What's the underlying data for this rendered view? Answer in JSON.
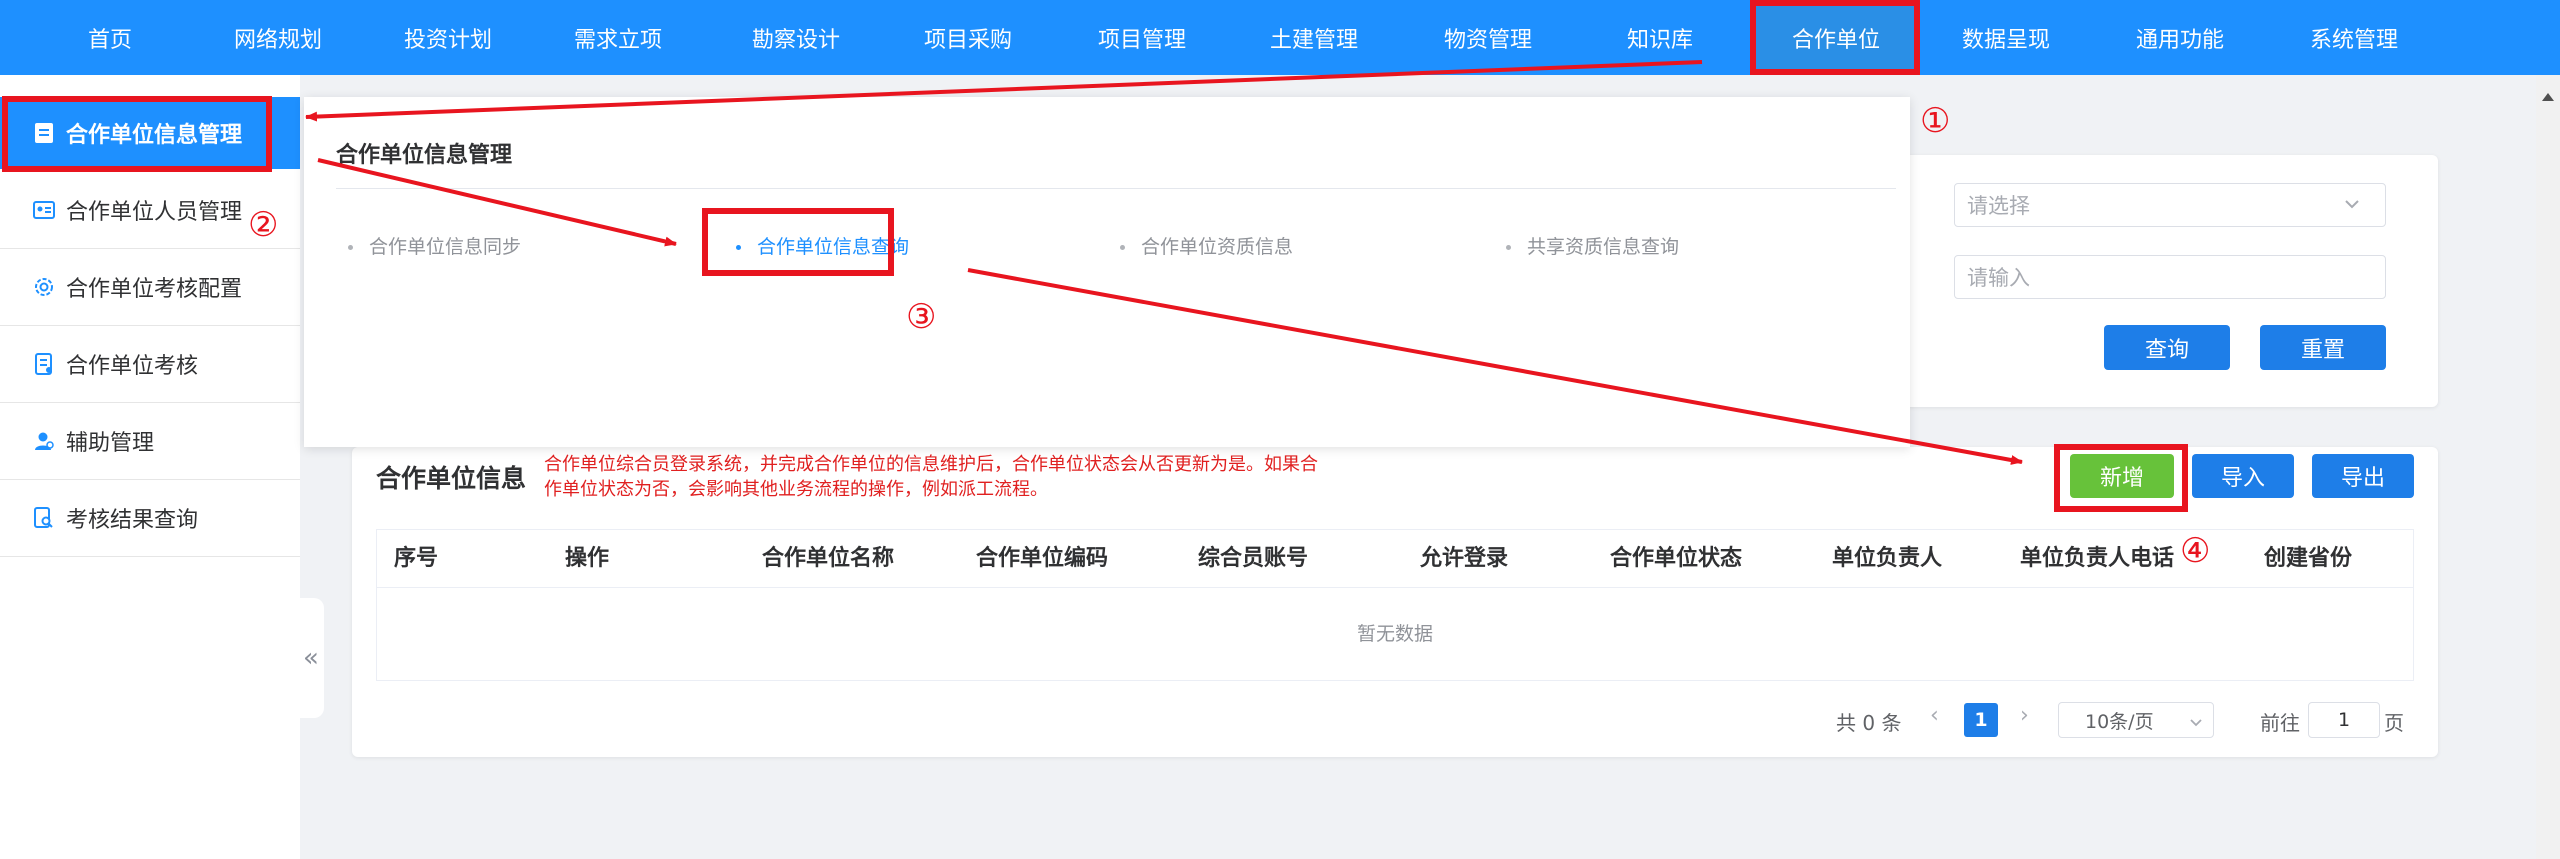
{
  "topnav": {
    "items": [
      {
        "label": "首页"
      },
      {
        "label": "网络规划"
      },
      {
        "label": "投资计划"
      },
      {
        "label": "需求立项"
      },
      {
        "label": "勘察设计"
      },
      {
        "label": "项目采购"
      },
      {
        "label": "项目管理"
      },
      {
        "label": "土建管理"
      },
      {
        "label": "物资管理"
      },
      {
        "label": "知识库"
      },
      {
        "label": "合作单位"
      },
      {
        "label": "数据呈现"
      },
      {
        "label": "通用功能"
      },
      {
        "label": "系统管理"
      }
    ],
    "active_index": 10
  },
  "sidebar": {
    "items": [
      {
        "label": "合作单位信息管理",
        "icon": "document-icon"
      },
      {
        "label": "合作单位人员管理",
        "icon": "id-card-icon"
      },
      {
        "label": "合作单位考核配置",
        "icon": "gear-icon"
      },
      {
        "label": "合作单位考核",
        "icon": "checklist-icon"
      },
      {
        "label": "辅助管理",
        "icon": "user-icon"
      },
      {
        "label": "考核结果查询",
        "icon": "search-document-icon"
      }
    ],
    "collapse_glyph": "«"
  },
  "megamenu": {
    "title": "合作单位信息管理",
    "links": [
      {
        "label": "合作单位信息同步"
      },
      {
        "label": "合作单位信息查询"
      },
      {
        "label": "合作单位资质信息"
      },
      {
        "label": "共享资质信息查询"
      }
    ]
  },
  "search": {
    "label_tail_1": ":",
    "label_tail_2": ":",
    "select_placeholder": "请选择",
    "input_placeholder": "请输入",
    "query_label": "查询",
    "reset_label": "重置"
  },
  "table_card": {
    "title": "合作单位信息",
    "note": "合作单位综合员登录系统，并完成合作单位的信息维护后，合作单位状态会从否更新为是。如果合作单位状态为否，会影响其他业务流程的操作，例如派工流程。",
    "add_label": "新增",
    "import_label": "导入",
    "export_label": "导出",
    "columns": [
      "序号",
      "操作",
      "合作单位名称",
      "合作单位编码",
      "综合员账号",
      "允许登录",
      "合作单位状态",
      "单位负责人",
      "单位负责人电话",
      "创建省份"
    ],
    "empty_text": "暂无数据"
  },
  "pagination": {
    "total_text": "共 0 条",
    "prev": "‹",
    "current_page": "1",
    "next": "›",
    "page_size": "10条/页",
    "goto_label": "前往",
    "goto_value": "1",
    "page_suffix": "页"
  },
  "annotations": {
    "step1": "①",
    "step2": "②",
    "step3": "③",
    "step4": "④",
    "color": "#e8151f"
  },
  "colors": {
    "primary": "#1e90ff",
    "button_blue": "#1e7ee8",
    "add_green": "#67c23a",
    "note_red": "#e02020"
  }
}
